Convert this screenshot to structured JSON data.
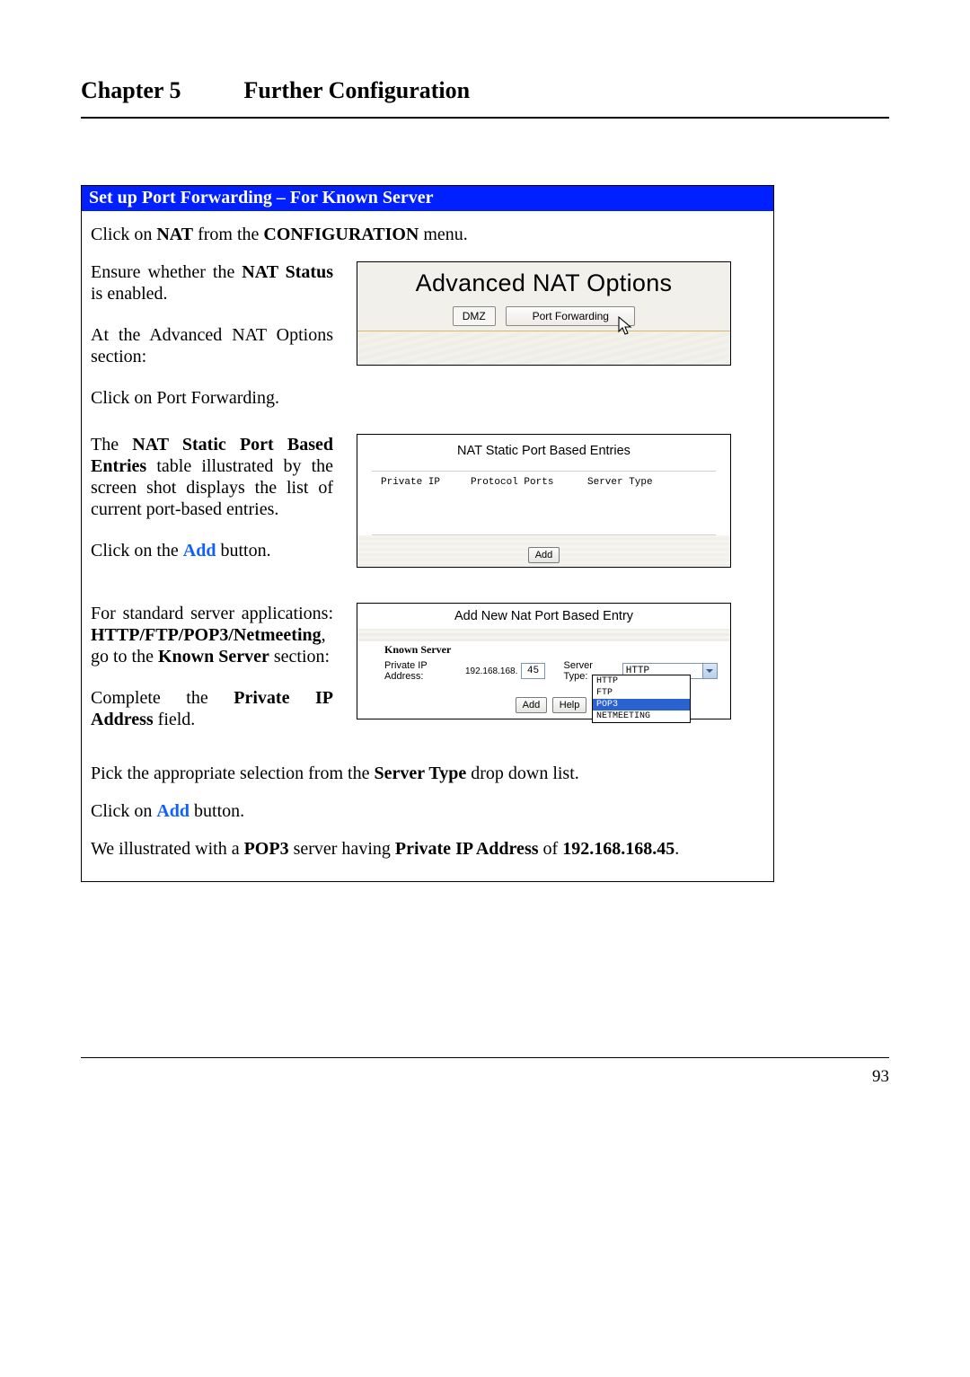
{
  "header": {
    "chapter": "Chapter 5",
    "title": "Further Configuration"
  },
  "panel": {
    "title": "Set up Port Forwarding – For Known Server",
    "intro": {
      "t1": "Click on ",
      "nat": "NAT",
      "t2": " from the ",
      "conf": "CONFIGURATION",
      "t3": " menu."
    },
    "ensure": {
      "t1": "Ensure whether the ",
      "bold": "NAT Status",
      "t2": " is enabled."
    },
    "at_adv": "At the Advanced NAT Options section:",
    "click_pf": "Click on Port Forwarding.",
    "entries_para": {
      "t1": "The ",
      "bold": "NAT Static Port Based Entries",
      "t2": " table illustrated by the screen shot displays the list of current port-based entries."
    },
    "click_add": {
      "t1": "Click on the ",
      "add": "Add",
      "t2": " button."
    },
    "stdapps": {
      "t1": "For standard server applications: ",
      "bold1": "HTTP/FTP/POP3/Netmeeting",
      "t2": ", go to the ",
      "bold2": "Known Server",
      "t3": " section:"
    },
    "complete": {
      "t1": "Complete the ",
      "bold": "Private IP Address",
      "t2": " field."
    },
    "pick": {
      "t1": "Pick the appropriate selection from the ",
      "bold": "Server Type",
      "t2": " drop down list."
    },
    "click_add2": {
      "t1": "Click on ",
      "add": "Add",
      "t2": " button."
    },
    "illustrated": {
      "t1": "We illustrated with a ",
      "pop3": "POP3",
      "t2": " server having ",
      "pip": "Private IP Address",
      "t3": " of ",
      "ip": "192.168.168.45",
      "t4": "."
    }
  },
  "shot1": {
    "title": "Advanced NAT Options",
    "tab_dmz": "DMZ",
    "tab_pf": "Port Forwarding"
  },
  "shot2": {
    "title": "NAT Static Port Based Entries",
    "col1": "Private IP",
    "col2": "Protocol Ports",
    "col3": "Server Type",
    "add": "Add"
  },
  "shot3": {
    "title": "Add New Nat Port Based Entry",
    "legend": "Known Server",
    "ip_label": "Private IP Address:",
    "ip_prefix": "192.168.168.",
    "ip_last": "45",
    "type_label": "Server Type:",
    "selected": "HTTP",
    "options": {
      "o1": "HTTP",
      "o2": "FTP",
      "o3": "POP3",
      "o4": "NETMEETING"
    },
    "btn_add": "Add",
    "btn_help": "Help"
  },
  "page_number": "93"
}
